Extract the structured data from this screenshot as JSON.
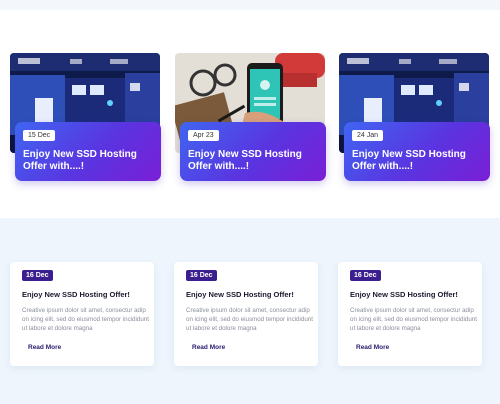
{
  "featured_posts": [
    {
      "date": "15 Dec",
      "title": "Enjoy New SSD Hosting Offer with....!",
      "image": "exhibition-booth-photo"
    },
    {
      "date": "Apr 23",
      "title": "Enjoy New SSD Hosting Offer with....!",
      "image": "smartphone-desk-photo"
    },
    {
      "date": "24 Jan",
      "title": "Enjoy New SSD Hosting Offer with....!",
      "image": "exhibition-booth-photo"
    }
  ],
  "blog_posts": [
    {
      "date": "16 Dec",
      "title": "Enjoy New SSD Hosting Offer!",
      "excerpt": "Creative ipsum dolor sit amet, consectur adip on icing elit, sed do eiusmod tempor incididunt ut labore et dolore magna",
      "link": "Read More"
    },
    {
      "date": "16 Dec",
      "title": "Enjoy New SSD Hosting Offer!",
      "excerpt": "Creative ipsum dolor sit amet, consectur adip on icing elit, sed do eiusmod tempor incididunt ut labore et dolore magna",
      "link": "Read More"
    },
    {
      "date": "16 Dec",
      "title": "Enjoy New SSD Hosting Offer!",
      "excerpt": "Creative ipsum dolor sit amet, consectur adip on icing elit, sed do eiusmod tempor incididunt ut labore et dolore magna",
      "link": "Read More"
    }
  ],
  "colors": {
    "gradient_start": "#3f66f2",
    "gradient_end": "#7a1fd6",
    "date_badge": "#3b1f8f",
    "section_bg": "#eef5fd"
  }
}
